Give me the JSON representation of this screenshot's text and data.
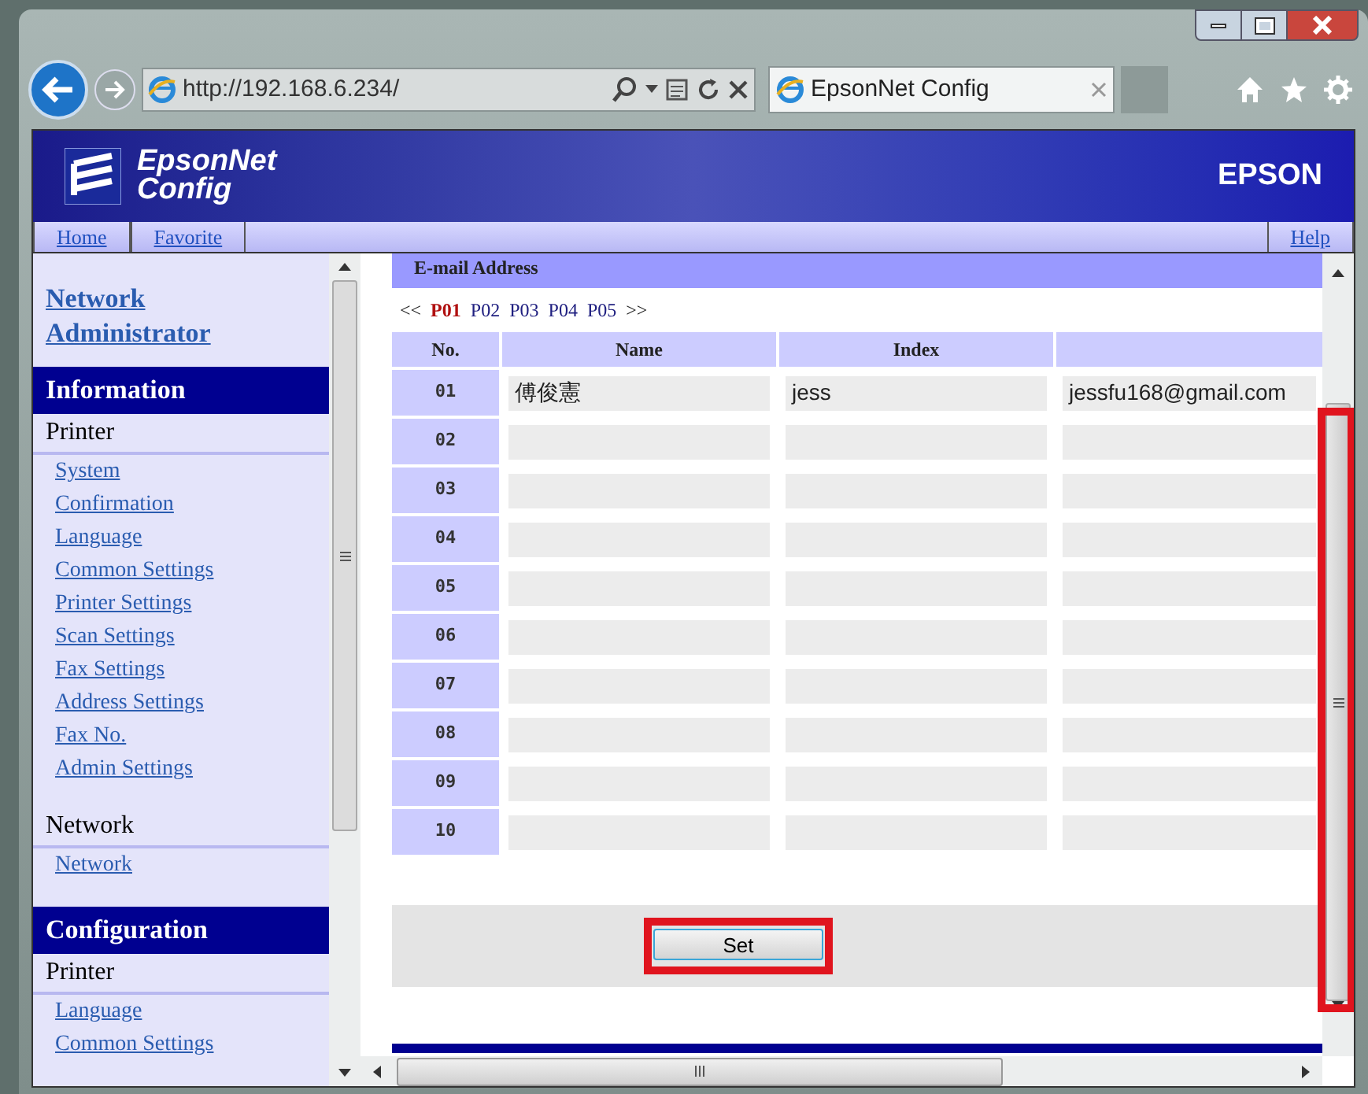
{
  "browser": {
    "url": "http://192.168.6.234/",
    "tab_title": "EpsonNet Config"
  },
  "banner": {
    "logo_lines": [
      "EpsonNet",
      "Config"
    ],
    "brand": "EPSON"
  },
  "nav": {
    "left": [
      "Home",
      "Favorite"
    ],
    "right": [
      "Help"
    ]
  },
  "sidebar": {
    "admin_link": "Network Administrator",
    "sections": [
      {
        "heading": "Information",
        "groups": [
          {
            "title": "Printer",
            "links": [
              "System",
              "Confirmation",
              "Language",
              "Common Settings",
              "Printer Settings",
              "Scan Settings",
              "Fax Settings",
              "Address Settings",
              "Fax No.",
              "Admin Settings"
            ]
          },
          {
            "title": "Network",
            "links": [
              "Network"
            ]
          }
        ]
      },
      {
        "heading": "Configuration",
        "groups": [
          {
            "title": "Printer",
            "links": [
              "Language",
              "Common Settings"
            ]
          }
        ]
      }
    ]
  },
  "main": {
    "section_title": "E-mail Address",
    "pager": {
      "prev": "<<",
      "next": ">>",
      "pages": [
        {
          "label": "P01",
          "selected": true
        },
        {
          "label": "P02",
          "selected": false
        },
        {
          "label": "P03",
          "selected": false
        },
        {
          "label": "P04",
          "selected": false
        },
        {
          "label": "P05",
          "selected": false
        }
      ]
    },
    "table": {
      "columns": [
        "No.",
        "Name",
        "Index"
      ],
      "rows": [
        {
          "no": "01",
          "name": "傅俊憲",
          "index": "jess",
          "email": "jessfu168@gmail.com"
        },
        {
          "no": "02"
        },
        {
          "no": "03"
        },
        {
          "no": "04"
        },
        {
          "no": "05"
        },
        {
          "no": "06"
        },
        {
          "no": "07"
        },
        {
          "no": "08"
        },
        {
          "no": "09"
        },
        {
          "no": "10"
        }
      ]
    },
    "set_button": {
      "label": "Set",
      "highlighted": true
    },
    "scrollbar": {
      "highlighted": true
    }
  }
}
